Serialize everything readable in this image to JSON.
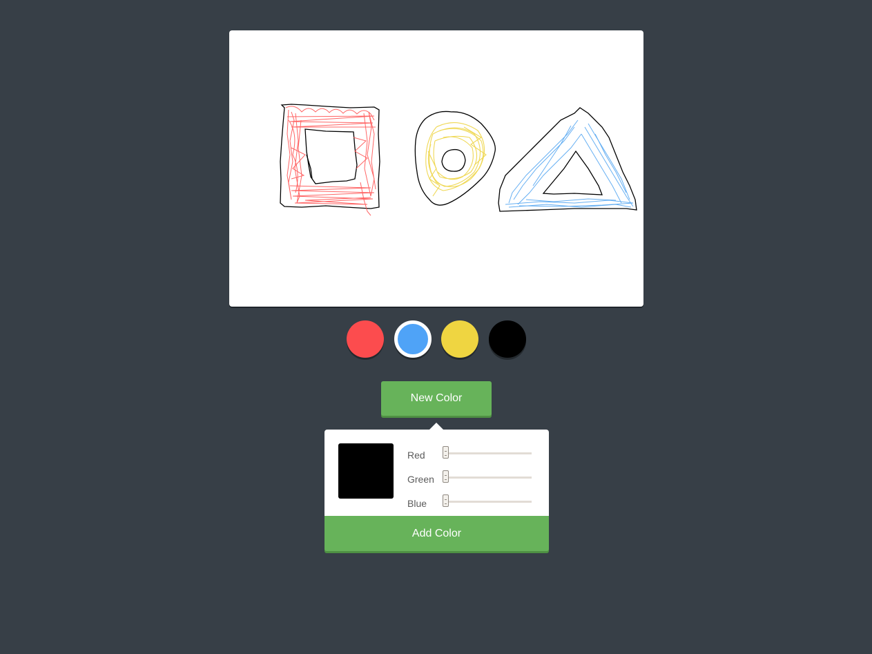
{
  "canvas": {
    "strokes": [
      {
        "color": "#000000",
        "shape": "square-outer"
      },
      {
        "color": "#ff4a4a",
        "shape": "square-scribble"
      },
      {
        "color": "#000000",
        "shape": "circle-outer"
      },
      {
        "color": "#eed443",
        "shape": "circle-scribble"
      },
      {
        "color": "#000000",
        "shape": "triangle-outer"
      },
      {
        "color": "#4aa1f0",
        "shape": "triangle-scribble"
      }
    ]
  },
  "palette": {
    "colors": [
      {
        "name": "red",
        "hex": "#fc4c4e",
        "selected": false
      },
      {
        "name": "blue",
        "hex": "#4fa3f7",
        "selected": true
      },
      {
        "name": "yellow",
        "hex": "#efd541",
        "selected": false
      },
      {
        "name": "black",
        "hex": "#000000",
        "selected": false
      }
    ]
  },
  "new_color_button": {
    "label": "New Color"
  },
  "color_picker": {
    "preview_color": "#000000",
    "sliders": [
      {
        "label": "Red",
        "value": 0,
        "max": 255
      },
      {
        "label": "Green",
        "value": 0,
        "max": 255
      },
      {
        "label": "Blue",
        "value": 0,
        "max": 255
      }
    ],
    "add_button": {
      "label": "Add Color"
    }
  },
  "accent_color": "#67b35a"
}
